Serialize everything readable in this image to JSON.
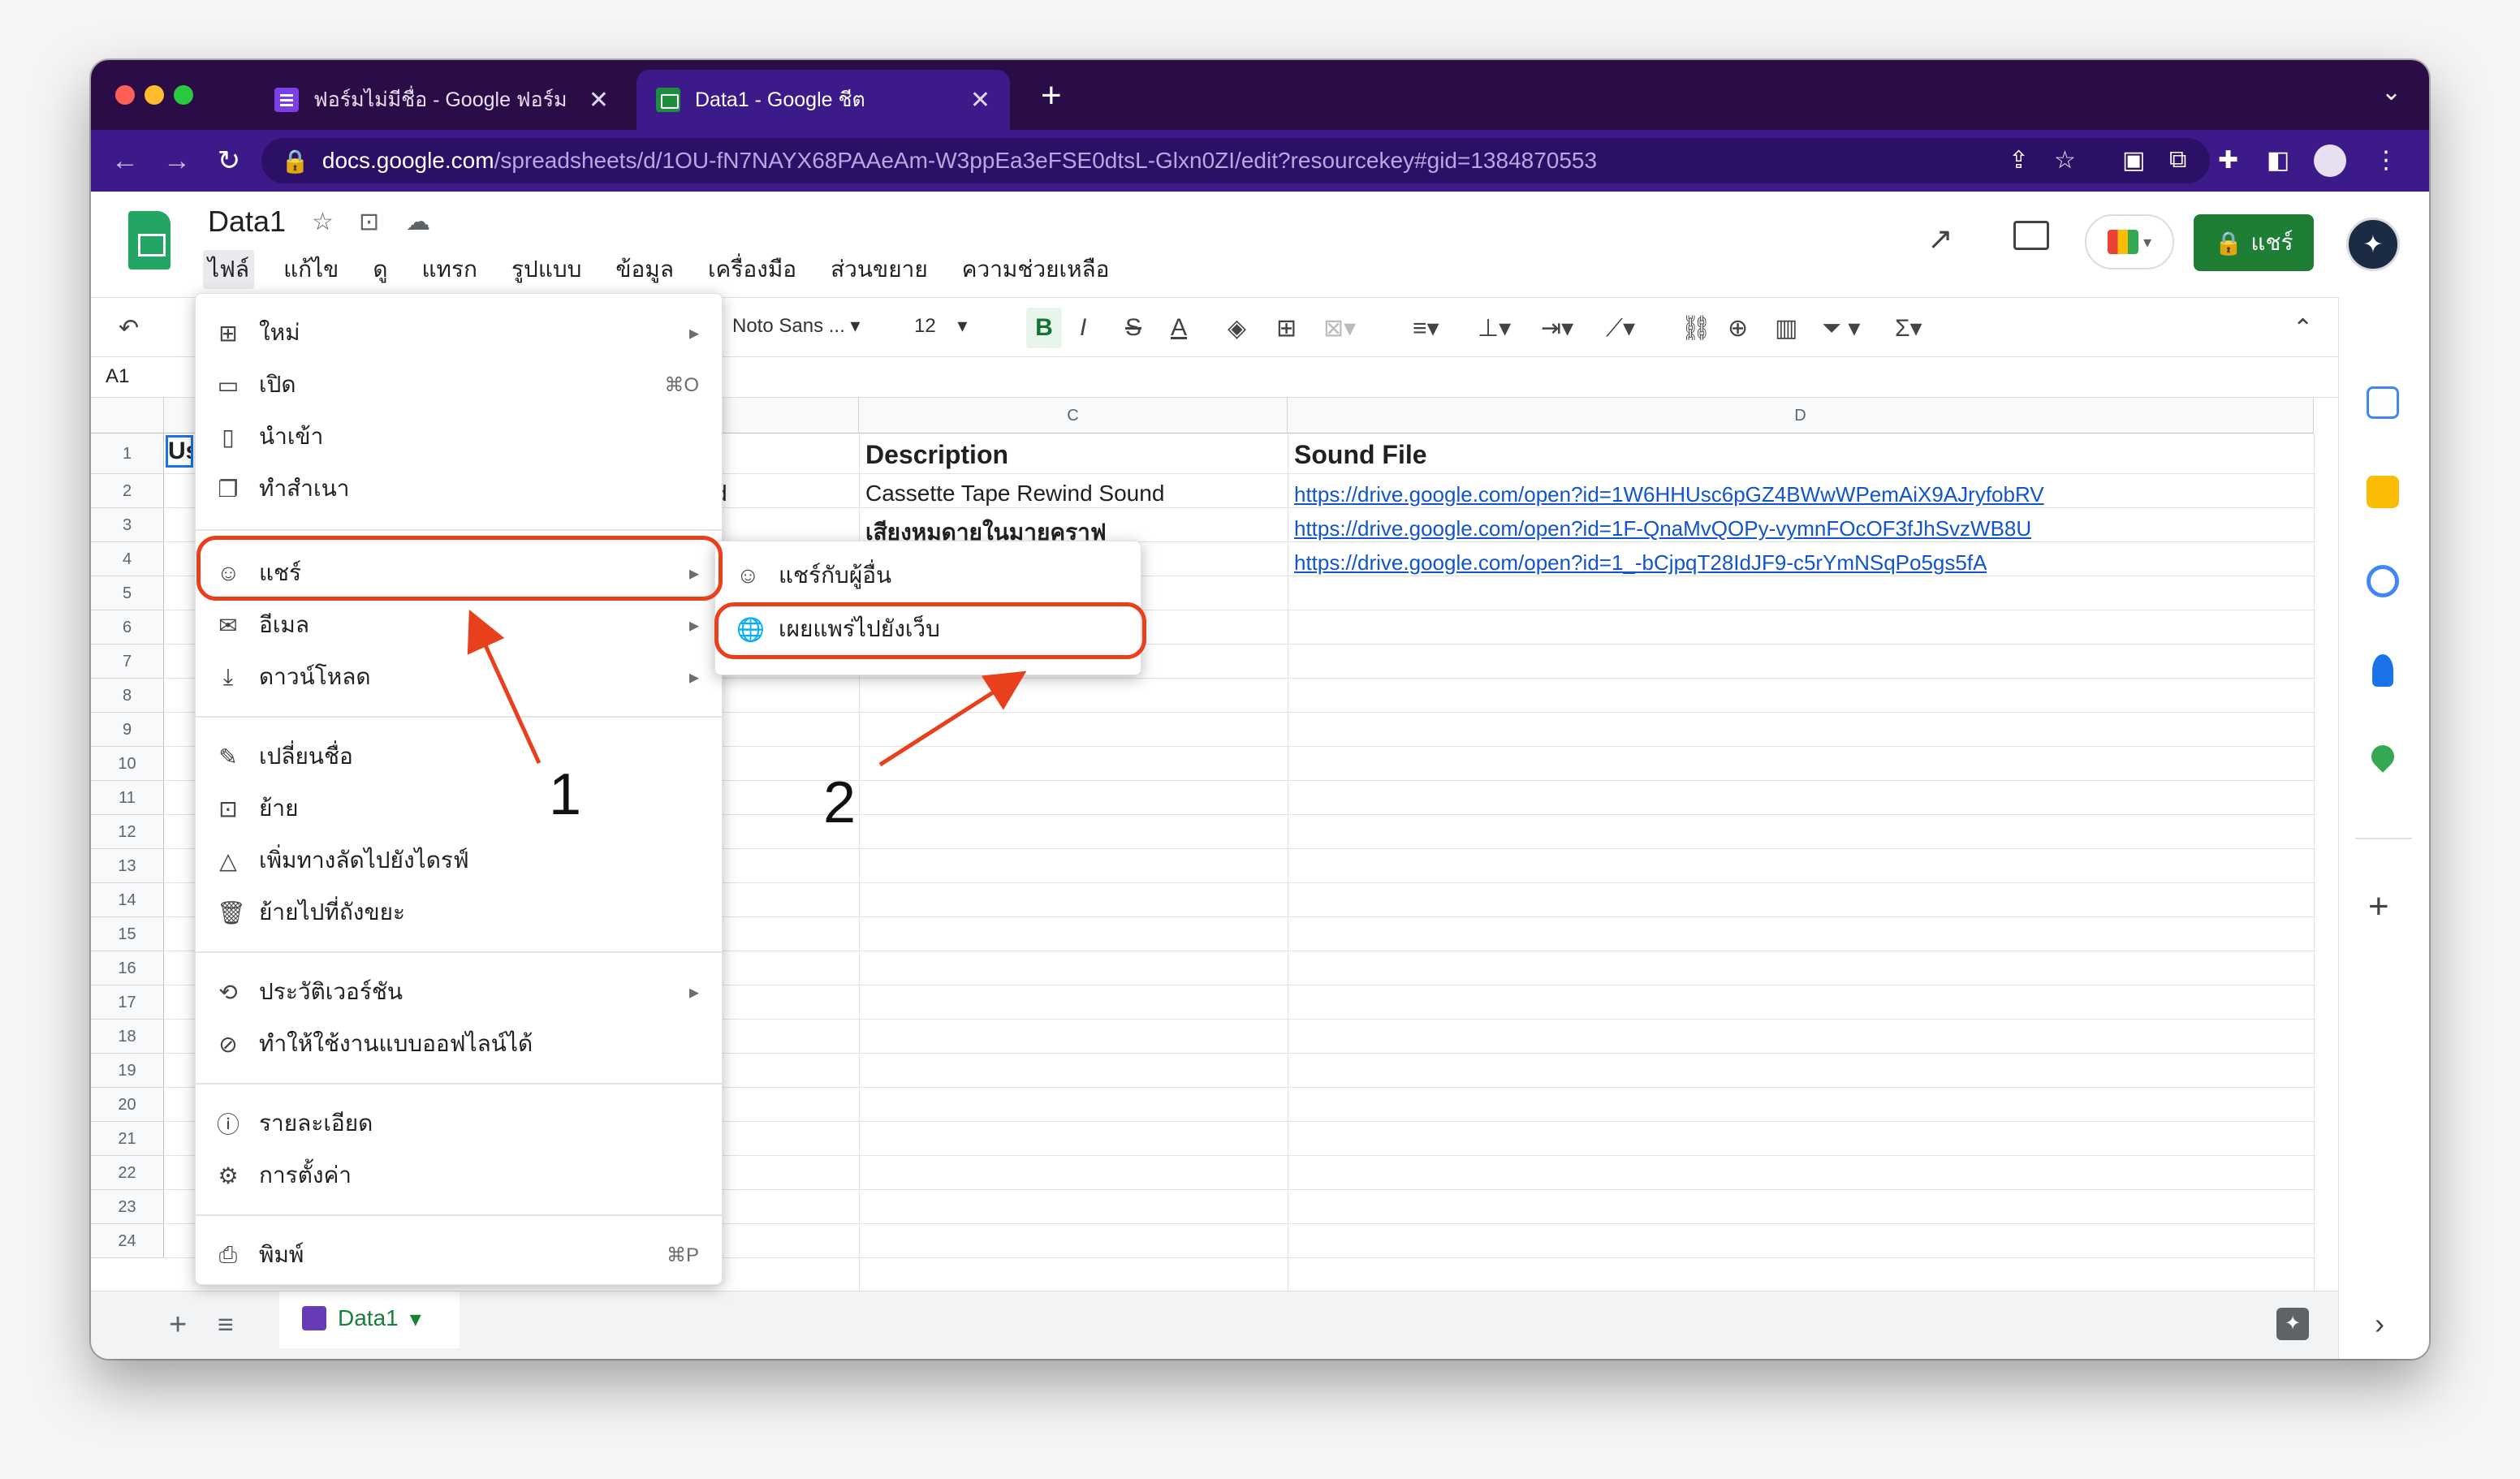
{
  "browser": {
    "tabs": [
      {
        "title": "ฟอร์มไม่มีชื่อ - Google ฟอร์ม",
        "icon": "google-forms-icon",
        "active": false
      },
      {
        "title": "Data1 - Google ชีต",
        "icon": "google-sheets-icon",
        "active": true
      }
    ],
    "new_tab": "+",
    "close": "✕",
    "url_host": "docs.google.com",
    "url_path": "/spreadsheets/d/1OU-fN7NAYX68PAAeAm-W3ppEa3eFSE0dtsL-Glxn0ZI/edit?resourcekey#gid=1384870553"
  },
  "app": {
    "doc_title": "Data1",
    "menus": [
      "ไฟล์",
      "แก้ไข",
      "ดู",
      "แทรก",
      "รูปแบบ",
      "ข้อมูล",
      "เครื่องมือ",
      "ส่วนขยาย",
      "ความช่วยเหลือ"
    ],
    "share_label": "แชร์",
    "font_name": "Noto Sans ...",
    "font_size": "12",
    "cell_ref": "A1"
  },
  "grid": {
    "columns": [
      "C",
      "D"
    ],
    "rows": [
      "1",
      "2",
      "3",
      "4",
      "5",
      "6",
      "7",
      "8",
      "9",
      "10",
      "11",
      "12",
      "13",
      "14",
      "15",
      "16",
      "17",
      "18",
      "19",
      "20",
      "21",
      "22",
      "23",
      "24"
    ],
    "a1_partial": "Us",
    "b2_partial": "d",
    "headers": {
      "description": "Description",
      "sound_file": "Sound File"
    },
    "descriptions": [
      "Cassette Tape Rewind Sound",
      "เสียงหมดายในมายคราฟ"
    ],
    "links": [
      "https://drive.google.com/open?id=1W6HHUsc6pGZ4BWwWPemAiX9AJryfobRV",
      "https://drive.google.com/open?id=1F-QnaMvQOPy-vymnFOcOF3fJhSvzWB8U",
      "https://drive.google.com/open?id=1_-bCjpqT28IdJF9-c5rYmNSqPo5gs5fA"
    ]
  },
  "file_menu": {
    "new": "ใหม่",
    "open": "เปิด",
    "open_shortcut": "⌘O",
    "import": "นำเข้า",
    "copy": "ทำสำเนา",
    "share": "แชร์",
    "email": "อีเมล",
    "download": "ดาวน์โหลด",
    "rename": "เปลี่ยนชื่อ",
    "move": "ย้าย",
    "add_shortcut": "เพิ่มทางลัดไปยังไดรฟ์",
    "trash": "ย้ายไปที่ถังขยะ",
    "version_history": "ประวัติเวอร์ชัน",
    "offline": "ทำให้ใช้งานแบบออฟไลน์ได้",
    "details": "รายละเอียด",
    "settings": "การตั้งค่า",
    "print": "พิมพ์",
    "print_shortcut": "⌘P",
    "submenu_arrow": "▸"
  },
  "share_submenu": {
    "share_with_others": "แชร์กับผู้อื่น",
    "publish_to_web": "เผยแพร่ไปยังเว็บ"
  },
  "annotations": {
    "step1": "1",
    "step2": "2",
    "color": "#e8401c"
  },
  "sheet_tab": {
    "name": "Data1",
    "add": "+",
    "list": "≡"
  }
}
